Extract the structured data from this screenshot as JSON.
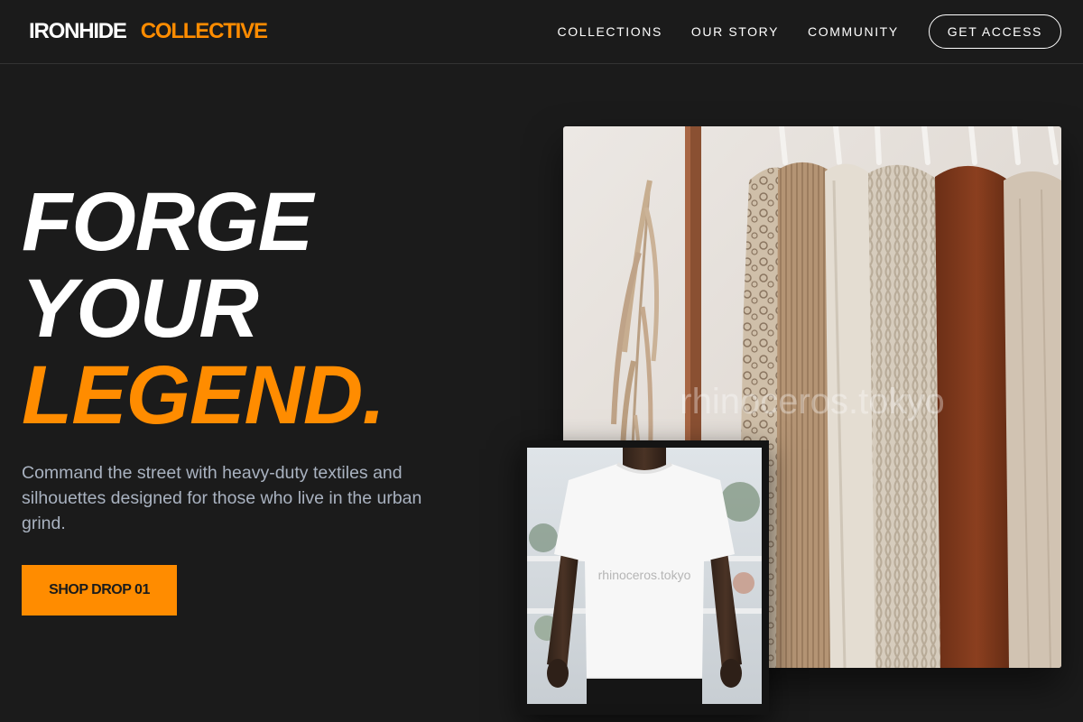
{
  "brand": {
    "name_part1": "IRONHIDE",
    "name_part2": "COLLECTIVE",
    "accent_color": "#ff8c00"
  },
  "nav": {
    "links": [
      {
        "label": "COLLECTIONS"
      },
      {
        "label": "OUR STORY"
      },
      {
        "label": "COMMUNITY"
      }
    ],
    "cta_label": "GET ACCESS"
  },
  "hero": {
    "headline_line1": "FORGE",
    "headline_line2": "YOUR",
    "headline_line3": "LEGEND.",
    "subcopy": "Command the street with heavy-duty textiles and silhouettes designed for those who live in the urban grind.",
    "button_label": "SHOP DROP 01"
  },
  "images": {
    "rack_watermark": "rhinoceros.tokyo",
    "tee_watermark": "rhinoceros.tokyo"
  },
  "colors": {
    "background": "#1b1b1b",
    "subtext": "#a9b2c0",
    "accent": "#ff8c00"
  }
}
